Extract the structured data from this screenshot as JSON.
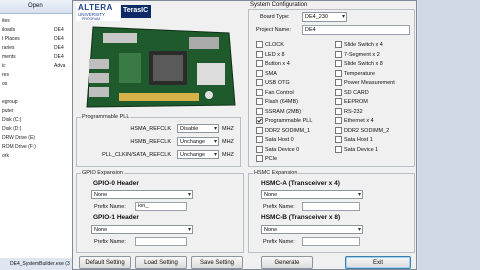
{
  "explorer": {
    "toolbar": "Open",
    "nav_items": [
      "ites",
      "iloads",
      "t Places",
      "raries",
      "ments",
      "ic",
      "res",
      "os",
      "",
      "egroup",
      "puter",
      "Disk (C:)",
      "Disk (D:)",
      "DRW Drive (E)",
      "ROM Drive (F:)",
      "ork"
    ],
    "files": [
      "DE4",
      "DE4",
      "DE4",
      "DE4",
      "Adva"
    ],
    "status": "DE4_SystemBuilder.exe  (3"
  },
  "brand": {
    "altera_line1": "ALTERA",
    "altera_line2": "UNIVERSITY",
    "altera_line3": "PROGRAM",
    "terasic": "TerasIC"
  },
  "system_config": {
    "title": "System Configuration",
    "board_type_label": "Board Type:",
    "board_type_value": "DE4_230",
    "project_name_label": "Project Name:",
    "project_name_value": "DE4",
    "checkboxes_left": [
      {
        "label": "CLOCK",
        "checked": false
      },
      {
        "label": "LED x 8",
        "checked": false
      },
      {
        "label": "Button x 4",
        "checked": false
      },
      {
        "label": "SMA",
        "checked": false
      },
      {
        "label": "USB OTG",
        "checked": false
      },
      {
        "label": "Fan Control",
        "checked": false
      },
      {
        "label": "Flash (64MB)",
        "checked": false
      },
      {
        "label": "SSRAM (2MB)",
        "checked": false
      },
      {
        "label": "Programmable PLL",
        "checked": true
      },
      {
        "label": "DDR2 SODIMM_1",
        "checked": false
      },
      {
        "label": "Sata Host 0",
        "checked": false
      },
      {
        "label": "Sata Device 0",
        "checked": false
      },
      {
        "label": "PCIe",
        "checked": false
      }
    ],
    "checkboxes_right": [
      {
        "label": "Slide Switch x 4",
        "checked": false
      },
      {
        "label": "7-Segment x 2",
        "checked": false
      },
      {
        "label": "Slide Switch x 8",
        "checked": false
      },
      {
        "label": "Temperature",
        "checked": false
      },
      {
        "label": "Power Measurement",
        "checked": false
      },
      {
        "label": "SD CARD",
        "checked": false
      },
      {
        "label": "EEPROM",
        "checked": false
      },
      {
        "label": "RS-232",
        "checked": false
      },
      {
        "label": "Ethernet x 4",
        "checked": false
      },
      {
        "label": "DDR2 SODIMM_2",
        "checked": false
      },
      {
        "label": "Sata Host 1",
        "checked": false
      },
      {
        "label": "Sata Device 1",
        "checked": false
      }
    ]
  },
  "pll": {
    "title": "Programmable PLL",
    "rows": [
      {
        "label": "HSMA_REFCLK",
        "value": "Disable",
        "unit": "MHZ"
      },
      {
        "label": "HSMB_REFCLK",
        "value": "Unchange",
        "unit": "MHZ"
      },
      {
        "label": "PLL_CLKIN/SATA_REFCLK",
        "value": "Unchange",
        "unit": "MHZ"
      }
    ]
  },
  "gpio": {
    "title": "GPIO Expansion",
    "h0": "GPIO-0 Header",
    "h0_select": "None",
    "h0_prefix_label": "Prefix Name:",
    "h0_prefix_value": "ion_",
    "h1": "GPIO-1 Header",
    "h1_select": "None",
    "h1_prefix_label": "Prefix Name:",
    "h1_prefix_value": ""
  },
  "hsmc": {
    "title": "HSMC Expansion",
    "a": "HSMC-A (Transceiver x 4)",
    "a_select": "None",
    "a_prefix_label": "Prefix Name:",
    "b": "HSMC-B (Transceiver x 8)",
    "b_select": "None",
    "b_prefix_label": "Prefix Name:"
  },
  "buttons": {
    "default": "Default Setting",
    "load": "Load Setting",
    "save": "Save Setting",
    "generate": "Generate",
    "exit": "Exit"
  }
}
